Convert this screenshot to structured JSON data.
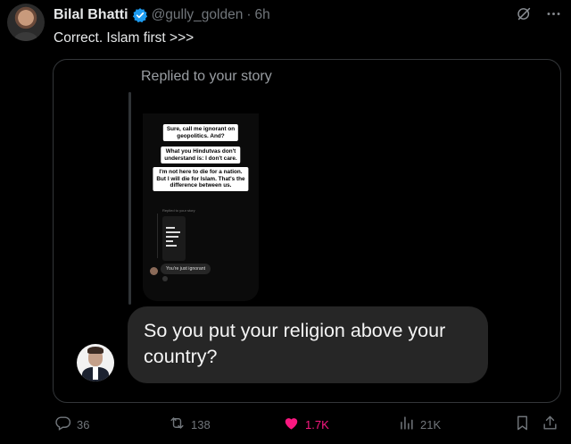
{
  "author": {
    "name": "Bilal Bhatti",
    "handle": "@gully_golden",
    "separator": "·",
    "time": "6h"
  },
  "tweet": {
    "text": "Correct. Islam first >>>"
  },
  "media": {
    "replied_label": "Replied to your story",
    "story_stickers": [
      "Sure, call me ignorant on\ngeopolitics. And?",
      "What you Hindutvas don't\nunderstand is: I don't care.",
      "I'm not here to die for a nation.\nBut I will die for Islam. That's the\ndifference between us."
    ],
    "mini_replied_label": "Replied to your story",
    "mini_reply": "You're just ignorant",
    "message": "So you put your religion above your country?"
  },
  "actions": {
    "replies": "36",
    "reposts": "138",
    "likes": "1.7K",
    "views": "21K"
  },
  "colors": {
    "background": "#000000",
    "text": "#e7e9ea",
    "muted": "#71767b",
    "verified": "#1d9bf0",
    "like": "#f91880",
    "bubble": "#262626"
  },
  "icons": [
    "verified-badge-icon",
    "grok-icon",
    "more-icon",
    "reply-icon",
    "repost-icon",
    "heart-icon",
    "views-icon",
    "bookmark-icon",
    "share-icon"
  ]
}
